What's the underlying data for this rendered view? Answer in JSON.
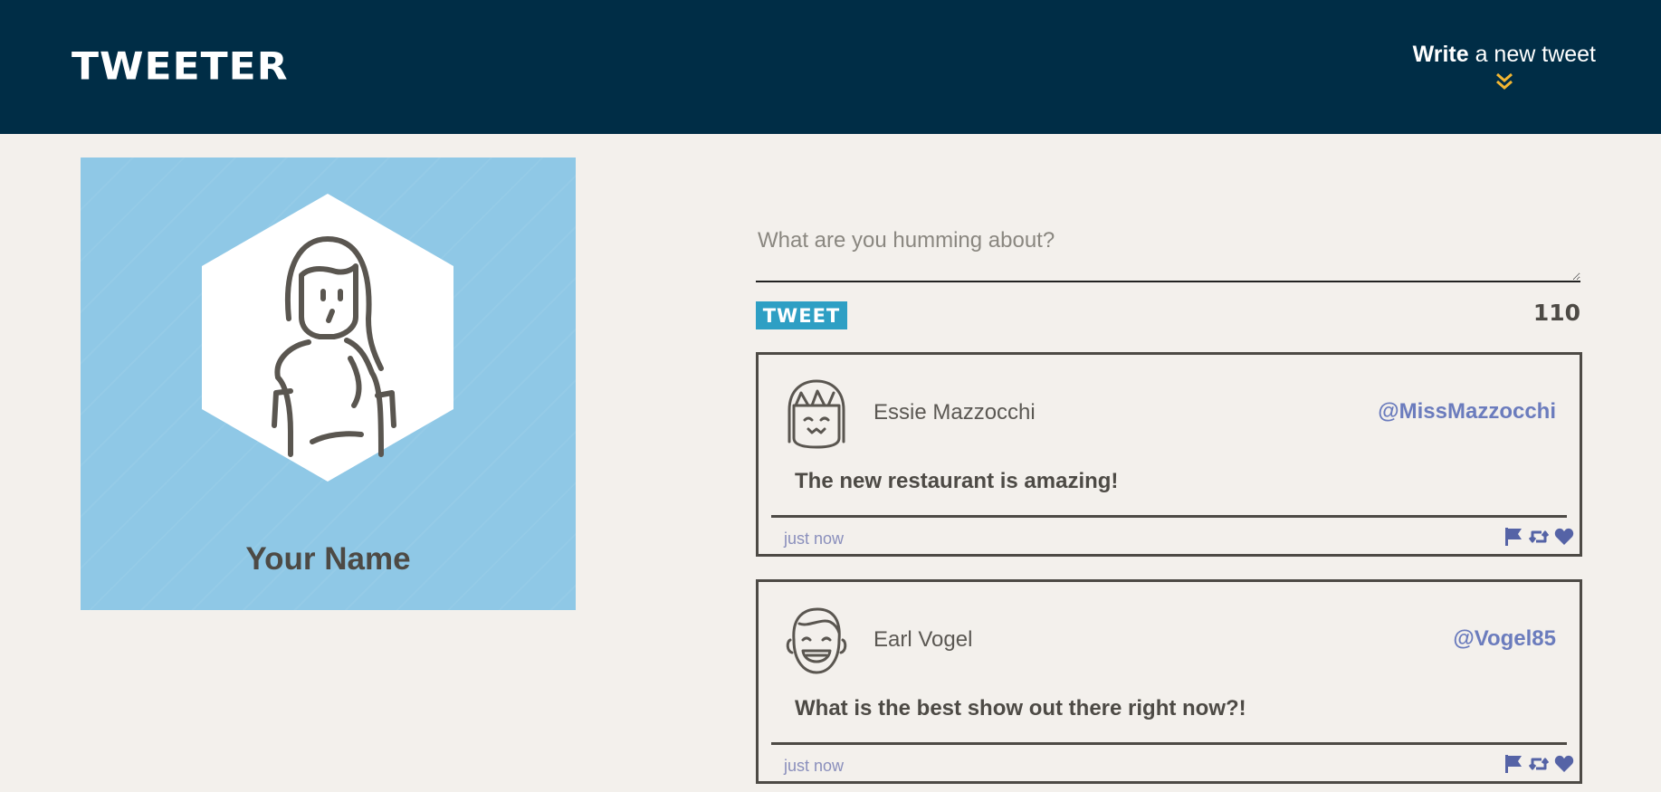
{
  "header": {
    "logo": "TWEETER",
    "write_bold": "Write",
    "write_rest": " a new tweet"
  },
  "profile": {
    "name": "Your Name"
  },
  "compose": {
    "placeholder": "What are you humming about?",
    "button_label": "TWEET",
    "counter": "110"
  },
  "tweets": [
    {
      "name": "Essie Mazzocchi",
      "handle": "@MissMazzocchi",
      "content": "The new restaurant is amazing!",
      "time": "just now"
    },
    {
      "name": "Earl Vogel",
      "handle": "@Vogel85",
      "content": "What is the best show out there right now?!",
      "time": "just now"
    }
  ],
  "colors": {
    "nav": "#002d46",
    "accent": "#2e9fc4",
    "handle": "#6b7cbd",
    "chevron": "#f2b632",
    "profile_bg": "#8fc8e6",
    "page_bg": "#f3f0ec"
  },
  "icons": [
    "double-chevron-down-icon",
    "flag-icon",
    "retweet-icon",
    "heart-icon"
  ]
}
